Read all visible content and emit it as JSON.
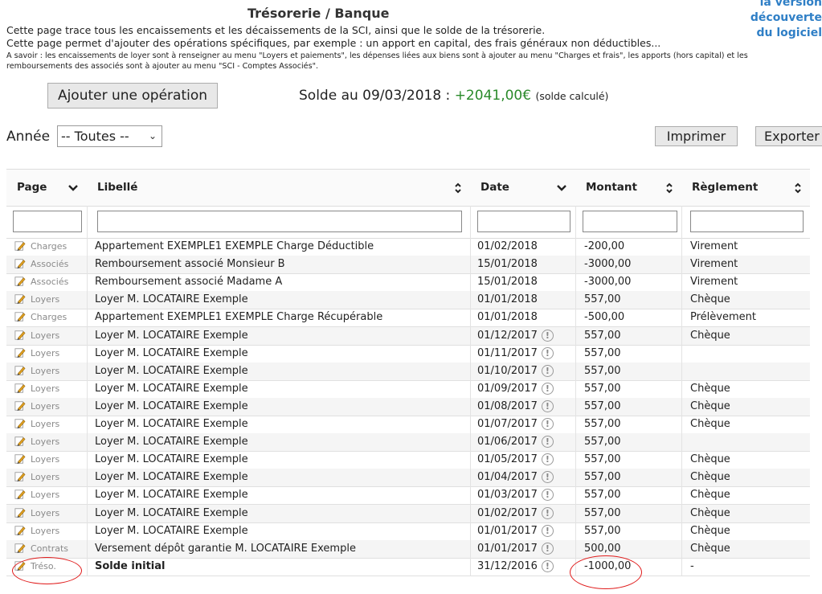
{
  "page": {
    "title": "Trésorerie / Banque",
    "side_note_lines": [
      "la version",
      "découverte",
      "du logiciel"
    ],
    "intro_1": "Cette page trace tous les encaissements et les décaissements de la SCI, ainsi que le solde de la trésorerie.",
    "intro_2": "Cette page permet d'ajouter des opérations spécifiques, par exemple : un apport en capital, des frais généraux non déductibles...",
    "intro_3": "A savoir : les encaissements de loyer sont à renseigner au menu \"Loyers et paiements\", les dépenses liées aux biens sont à ajouter au menu \"Charges et frais\", les apports (hors capital) et les remboursements des associés sont à ajouter au menu \"SCI - Comptes Associés\"."
  },
  "toolbar": {
    "add_label": "Ajouter une opération",
    "solde_label": "Solde au 09/03/2018 :",
    "solde_amount": "+2041,00€",
    "solde_note": "(solde calculé)",
    "year_label": "Année",
    "year_selected": "-- Toutes --",
    "print_label": "Imprimer",
    "export_label": "Exporter"
  },
  "colors": {
    "positive": "#2a8a2a",
    "link": "#2f7fc6",
    "annotation": "#e01b1b"
  },
  "table": {
    "columns": [
      {
        "label": "Page",
        "sort": "chevron-down"
      },
      {
        "label": "Libellé",
        "sort": "updown"
      },
      {
        "label": "Date",
        "sort": "chevron-down"
      },
      {
        "label": "Montant",
        "sort": "updown"
      },
      {
        "label": "Règlement",
        "sort": "updown"
      }
    ],
    "rows": [
      {
        "page": "Charges",
        "libelle": "Appartement EXEMPLE1 EXEMPLE Charge Déductible",
        "date": "01/02/2018",
        "warn": false,
        "montant": "-200,00",
        "reglement": "Virement"
      },
      {
        "page": "Associés",
        "libelle": "Remboursement associé Monsieur B",
        "date": "15/01/2018",
        "warn": false,
        "montant": "-3000,00",
        "reglement": "Virement"
      },
      {
        "page": "Associés",
        "libelle": "Remboursement associé Madame A",
        "date": "15/01/2018",
        "warn": false,
        "montant": "-3000,00",
        "reglement": "Virement"
      },
      {
        "page": "Loyers",
        "libelle": "Loyer M. LOCATAIRE Exemple",
        "date": "01/01/2018",
        "warn": false,
        "montant": "557,00",
        "reglement": "Chèque"
      },
      {
        "page": "Charges",
        "libelle": "Appartement EXEMPLE1 EXEMPLE Charge Récupérable",
        "date": "01/01/2018",
        "warn": false,
        "montant": "-500,00",
        "reglement": "Prélèvement"
      },
      {
        "page": "Loyers",
        "libelle": "Loyer M. LOCATAIRE Exemple",
        "date": "01/12/2017",
        "warn": true,
        "montant": "557,00",
        "reglement": "Chèque"
      },
      {
        "page": "Loyers",
        "libelle": "Loyer M. LOCATAIRE Exemple",
        "date": "01/11/2017",
        "warn": true,
        "montant": "557,00",
        "reglement": ""
      },
      {
        "page": "Loyers",
        "libelle": "Loyer M. LOCATAIRE Exemple",
        "date": "01/10/2017",
        "warn": true,
        "montant": "557,00",
        "reglement": ""
      },
      {
        "page": "Loyers",
        "libelle": "Loyer M. LOCATAIRE Exemple",
        "date": "01/09/2017",
        "warn": true,
        "montant": "557,00",
        "reglement": "Chèque"
      },
      {
        "page": "Loyers",
        "libelle": "Loyer M. LOCATAIRE Exemple",
        "date": "01/08/2017",
        "warn": true,
        "montant": "557,00",
        "reglement": "Chèque"
      },
      {
        "page": "Loyers",
        "libelle": "Loyer M. LOCATAIRE Exemple",
        "date": "01/07/2017",
        "warn": true,
        "montant": "557,00",
        "reglement": "Chèque"
      },
      {
        "page": "Loyers",
        "libelle": "Loyer M. LOCATAIRE Exemple",
        "date": "01/06/2017",
        "warn": true,
        "montant": "557,00",
        "reglement": ""
      },
      {
        "page": "Loyers",
        "libelle": "Loyer M. LOCATAIRE Exemple",
        "date": "01/05/2017",
        "warn": true,
        "montant": "557,00",
        "reglement": "Chèque"
      },
      {
        "page": "Loyers",
        "libelle": "Loyer M. LOCATAIRE Exemple",
        "date": "01/04/2017",
        "warn": true,
        "montant": "557,00",
        "reglement": "Chèque"
      },
      {
        "page": "Loyers",
        "libelle": "Loyer M. LOCATAIRE Exemple",
        "date": "01/03/2017",
        "warn": true,
        "montant": "557,00",
        "reglement": "Chèque"
      },
      {
        "page": "Loyers",
        "libelle": "Loyer M. LOCATAIRE Exemple",
        "date": "01/02/2017",
        "warn": true,
        "montant": "557,00",
        "reglement": "Chèque"
      },
      {
        "page": "Loyers",
        "libelle": "Loyer M. LOCATAIRE Exemple",
        "date": "01/01/2017",
        "warn": true,
        "montant": "557,00",
        "reglement": "Chèque"
      },
      {
        "page": "Contrats",
        "libelle": "Versement dépôt garantie M. LOCATAIRE Exemple",
        "date": "01/01/2017",
        "warn": true,
        "montant": "500,00",
        "reglement": "Chèque"
      },
      {
        "page": "Tréso.",
        "libelle": "Solde initial",
        "date": "31/12/2016",
        "warn": true,
        "montant": "-1000,00",
        "reglement": "-",
        "bold": true
      }
    ]
  }
}
